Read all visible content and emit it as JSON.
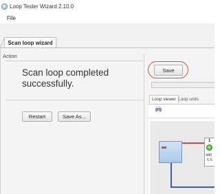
{
  "window": {
    "title": "Loop Tester Wizard 2.10.0",
    "app_icon": "app-logo-icon"
  },
  "menu": {
    "items": [
      {
        "label": "File"
      }
    ]
  },
  "tabs": {
    "main": [
      {
        "label": "Scan loop wizard",
        "active": true
      }
    ]
  },
  "action": {
    "legend": "Action",
    "status_message": "Scan loop completed successfully.",
    "restart_label": "Restart",
    "save_as_label": "Save As..."
  },
  "right": {
    "save_label": "Save",
    "highlight_color": "#e0503a",
    "viewer_tabs": [
      {
        "label": "Loop viewer",
        "active": true
      },
      {
        "label": "Loop units",
        "active": false
      }
    ],
    "print_icon": "printer-icon"
  },
  "diagram": {
    "node_number": "1",
    "node_code": "440",
    "node_sub": "5.5",
    "led_color": "#3fa620",
    "signal_wire_color": "#d9453a",
    "bus_wire_color": "#3b57c8"
  }
}
